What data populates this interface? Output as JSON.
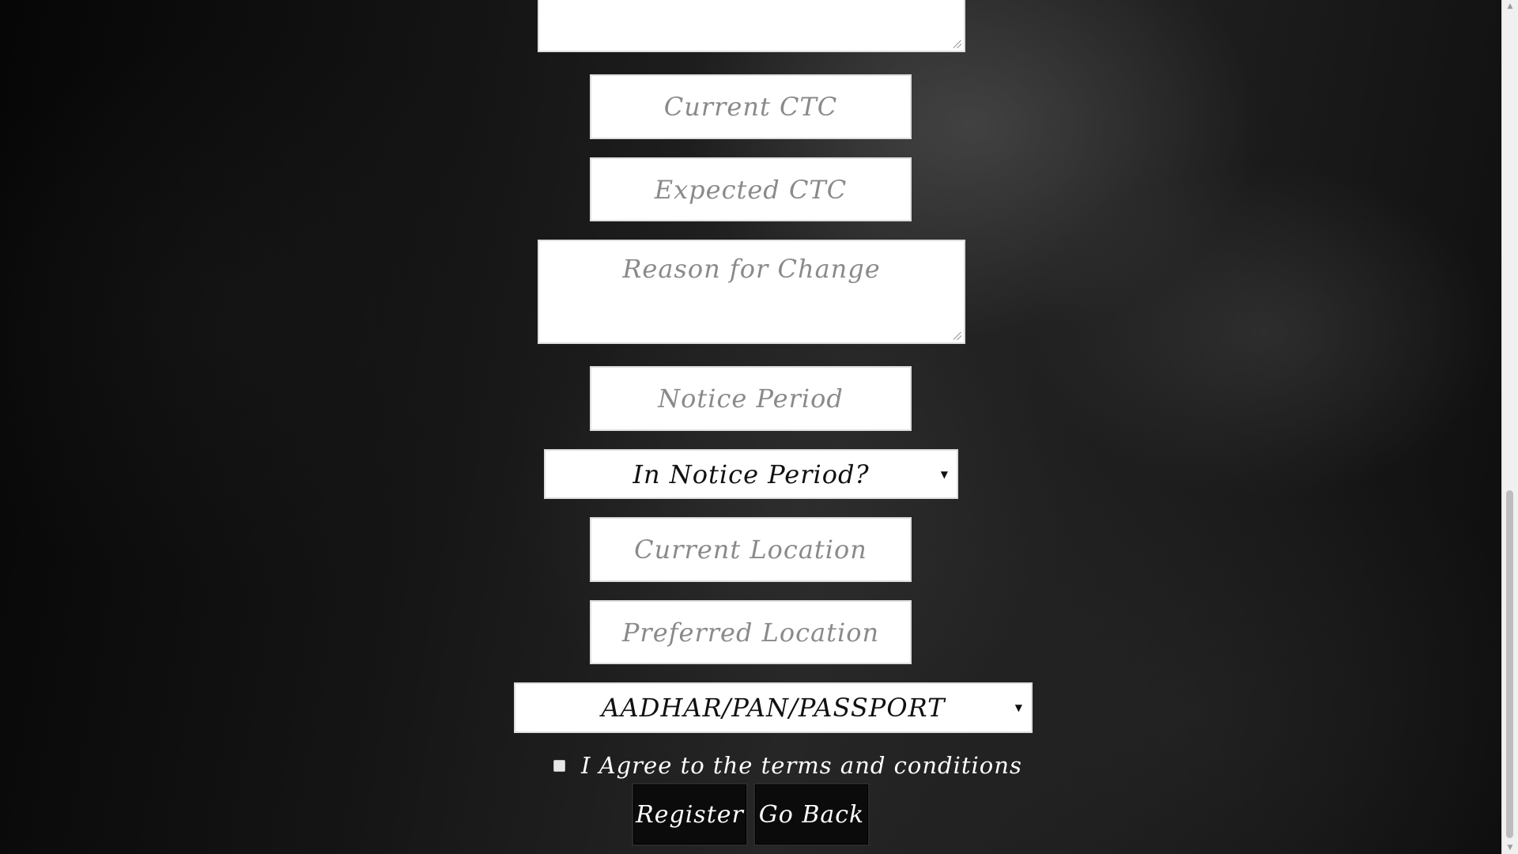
{
  "form": {
    "previous_textarea": {
      "placeholder": ""
    },
    "current_ctc": {
      "placeholder": "Current CTC"
    },
    "expected_ctc": {
      "placeholder": "Expected CTC"
    },
    "reason_for_change": {
      "placeholder": "Reason for Change"
    },
    "notice_period": {
      "placeholder": "Notice Period"
    },
    "in_notice_period_select": {
      "selected": "In Notice Period?"
    },
    "current_location": {
      "placeholder": "Current Location"
    },
    "preferred_location": {
      "placeholder": "Preferred Location"
    },
    "id_type_select": {
      "selected": "AADHAR/PAN/PASSPORT"
    },
    "terms": {
      "label": "I Agree to the terms and conditions",
      "checked": false
    },
    "register_button": {
      "label": "Register"
    },
    "go_back_button": {
      "label": "Go Back"
    }
  },
  "scrollbar": {
    "up_icon": "scroll-up-arrow",
    "down_icon": "scroll-down-arrow"
  }
}
